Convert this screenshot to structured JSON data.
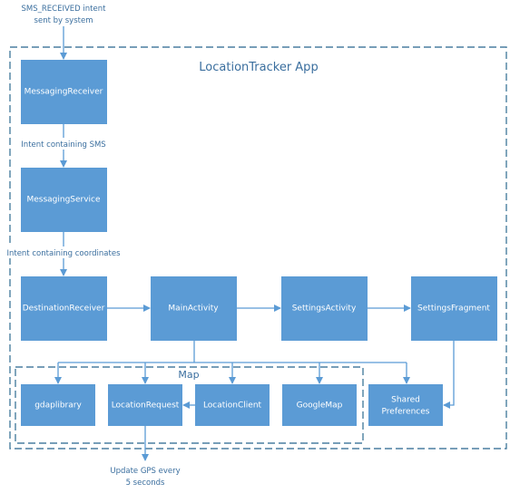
{
  "top_label": [
    "SMS_RECEIVED intent",
    "sent by system"
  ],
  "app_title": "LocationTracker App",
  "map_title": "Map",
  "edges": {
    "sms_label": "Intent containing SMS",
    "coords_label": "Intent containing coordinates",
    "gps_label": [
      "Update GPS every",
      "5 seconds"
    ]
  },
  "nodes": {
    "messaging_receiver": "MessagingReceiver",
    "messaging_service": "MessagingService",
    "destination_receiver": "DestinationReceiver",
    "main_activity": "MainActivity",
    "settings_activity": "SettingsActivity",
    "settings_fragment": "SettingsFragment",
    "gdaplibrary": "gdaplibrary",
    "location_request": "LocationRequest",
    "location_client": "LocationClient",
    "google_map": "GoogleMap",
    "shared_preferences": [
      "Shared",
      "Preferences"
    ]
  },
  "colors": {
    "box": "#5b9bd5",
    "line": "#5b9bd5",
    "dashed_border": "#4a7fa0",
    "label_text": "#3a6e9e"
  }
}
